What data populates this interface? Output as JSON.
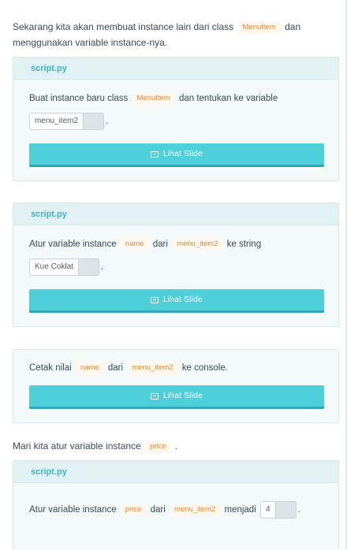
{
  "intro": {
    "text_before": "Sekarang kita akan membuat instance lain dari class",
    "code": "MenuItem",
    "text_after": "dan menggunakan variable instance-nya."
  },
  "cards": [
    {
      "header": "script.py",
      "instruction": {
        "text_before": "Buat instance baru class",
        "code": "MenuItem",
        "text_after": "dan tentukan ke variable"
      },
      "input_value": "menu_item2",
      "input_suffix": ".",
      "button_label": "Lihat Slide"
    },
    {
      "header": "script.py",
      "instruction": {
        "text_before": "Atur variable instance",
        "code1": "name",
        "text_mid": "dari",
        "code2": "menu_item2",
        "text_after": "ke string"
      },
      "input_value": "Kue Coklat",
      "input_suffix": ".",
      "button_label": "Lihat Slide"
    },
    {
      "instruction": {
        "text_before": "Cetak nilai",
        "code1": "name",
        "text_mid": "dari",
        "code2": "menu_item2",
        "text_after": "ke console."
      },
      "button_label": "Lihat Slide"
    },
    {
      "header": "script.py",
      "instruction": {
        "text_before": "Atur variable instance",
        "code1": "price",
        "text_mid": "dari",
        "code2": "menu_item2",
        "text_after": "menjadi"
      },
      "input_value": "4",
      "input_suffix": "."
    }
  ],
  "price_intro": {
    "text_before": "Mari kita atur variable instance",
    "code": "price",
    "text_after": "."
  },
  "colors": {
    "accent": "#4ecfda",
    "accent_dark": "#2fa7b4",
    "code_text": "#e28a39",
    "header_text": "#3fb5c6"
  },
  "icons": {
    "slide": "slide-icon"
  }
}
